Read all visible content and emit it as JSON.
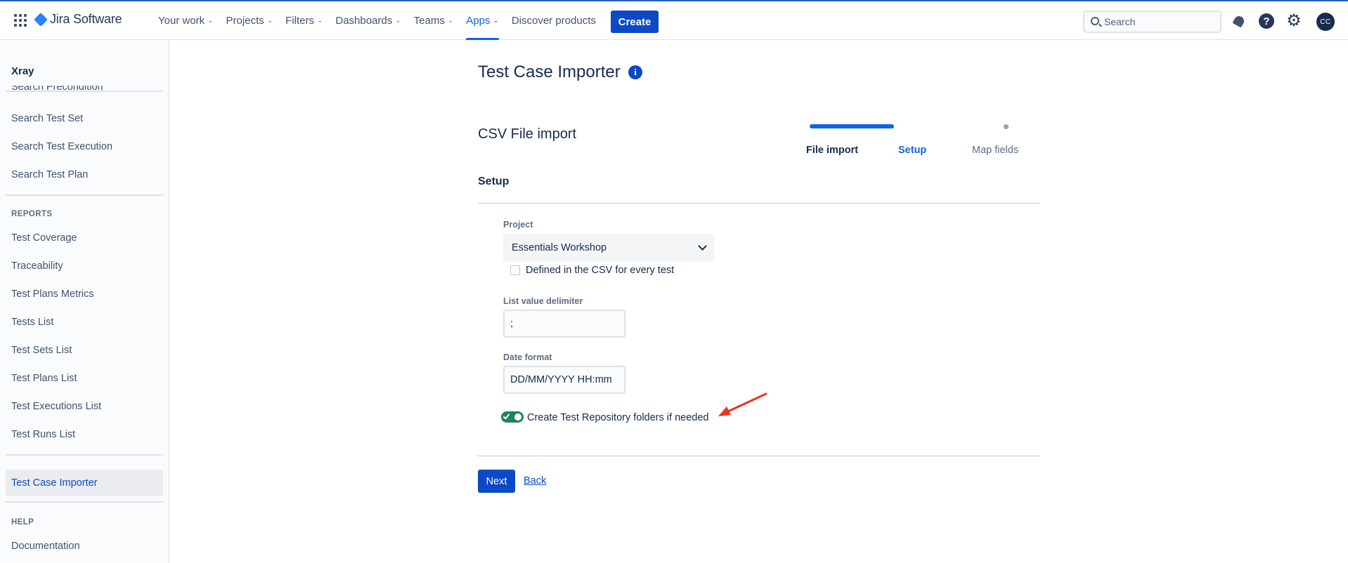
{
  "topnav": {
    "apps_icon": "apps-grid-icon",
    "logo": {
      "brand": "Jira",
      "product": "Software"
    },
    "items": [
      {
        "label": "Your work",
        "has_chevron": true
      },
      {
        "label": "Projects",
        "has_chevron": true
      },
      {
        "label": "Filters",
        "has_chevron": true
      },
      {
        "label": "Dashboards",
        "has_chevron": true
      },
      {
        "label": "Teams",
        "has_chevron": true
      },
      {
        "label": "Apps",
        "has_chevron": true,
        "active": true
      },
      {
        "label": "Discover products",
        "has_chevron": false
      }
    ],
    "create_label": "Create",
    "search_placeholder": "Search",
    "avatar_initials": "CC"
  },
  "sidebar": {
    "title": "Xray",
    "partial_item": "Search Precondition",
    "items_top": [
      "Search Test Set",
      "Search Test Execution",
      "Search Test Plan"
    ],
    "reports_heading": "REPORTS",
    "report_items": [
      "Test Coverage",
      "Traceability",
      "Test Plans Metrics",
      "Tests List",
      "Test Sets List",
      "Test Plans List",
      "Test Executions List",
      "Test Runs List"
    ],
    "selected_item": "Test Case Importer",
    "help_heading": "HELP",
    "help_items": [
      "Documentation"
    ]
  },
  "main": {
    "page_title": "Test Case Importer",
    "info_icon_glyph": "i",
    "section_title": "CSV File import",
    "steps": [
      {
        "label": "File import",
        "state": "done"
      },
      {
        "label": "Setup",
        "state": "current"
      },
      {
        "label": "Map fields",
        "state": "pending"
      }
    ],
    "sub_title": "Setup",
    "project_label": "Project",
    "project_value": "Essentials Workshop",
    "csv_checkbox_label": "Defined in the CSV for every test",
    "csv_checkbox_checked": false,
    "delimiter_label": "List value delimiter",
    "delimiter_value": ";",
    "date_format_label": "Date format",
    "date_format_value": "DD/MM/YYYY HH:mm",
    "toggle_label": "Create Test Repository folders if needed",
    "toggle_on": true,
    "next_label": "Next",
    "back_label": "Back"
  },
  "colors": {
    "primary": "#0c49c6",
    "active_blue": "#0c66e4",
    "toggle_green": "#1f845a",
    "annotation_arrow": "#e8361f"
  }
}
